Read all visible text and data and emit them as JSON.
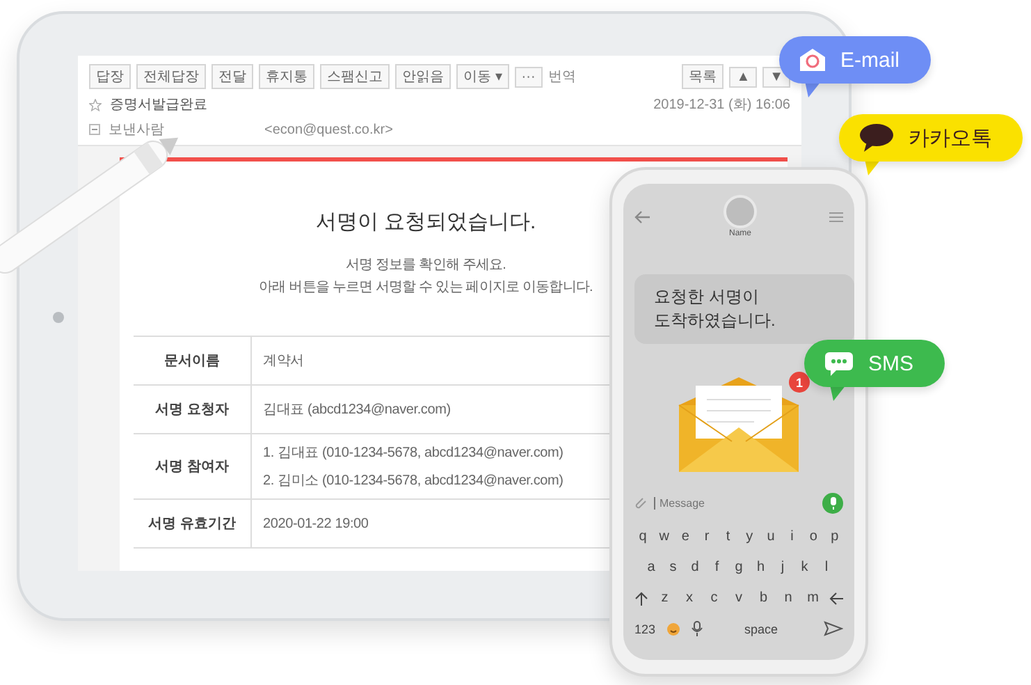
{
  "mail_toolbar": {
    "buttons": [
      "답장",
      "전체답장",
      "전달",
      "휴지통",
      "스팸신고",
      "안읽음",
      "이동 ▾",
      "···"
    ],
    "translate": "번역",
    "nav_buttons": [
      "목록",
      "▲",
      "▼"
    ]
  },
  "mail_header": {
    "starred": false,
    "subject": "증명서발급완료",
    "sender_label": "보낸사람",
    "sender_address": "<econ@quest.co.kr>",
    "date": "2019-12-31 (화) 16:06"
  },
  "mail_body": {
    "title": "서명이 요청되었습니다.",
    "lines": [
      "서명 정보를 확인해 주세요.",
      "아래 버튼을 누르면 서명할 수 있는 페이지로 이동합니다."
    ],
    "table": [
      {
        "label": "문서이름",
        "values": [
          "계약서"
        ]
      },
      {
        "label": "서명 요청자",
        "values": [
          "김대표 (abcd1234@naver.com)"
        ]
      },
      {
        "label": "서명 참여자",
        "values": [
          "1. 김대표 (010-1234-5678, abcd1234@naver.com)",
          "2. 김미소 (010-1234-5678, abcd1234@naver.com)"
        ]
      },
      {
        "label": "서명 유효기간",
        "values": [
          "2020-01-22 19:00"
        ]
      }
    ]
  },
  "phone": {
    "contact": "Name",
    "message": "요청한 서명이\n도착하였습니다.",
    "badge": "1",
    "placeholder": "Message",
    "key_rows": [
      [
        "q",
        "w",
        "e",
        "r",
        "t",
        "y",
        "u",
        "i",
        "o",
        "p"
      ],
      [
        "a",
        "s",
        "d",
        "f",
        "g",
        "h",
        "j",
        "k",
        "l"
      ],
      [
        "z",
        "x",
        "c",
        "v",
        "b",
        "n",
        "m"
      ]
    ],
    "numbers_key": "123",
    "space_key": "space"
  },
  "channels": [
    {
      "kind": "email",
      "label": "E-mail",
      "color": "#6e8ef5"
    },
    {
      "kind": "kakao",
      "label": "카카오톡",
      "color": "#fae100"
    },
    {
      "kind": "sms",
      "label": "SMS",
      "color": "#3dba4e"
    }
  ]
}
